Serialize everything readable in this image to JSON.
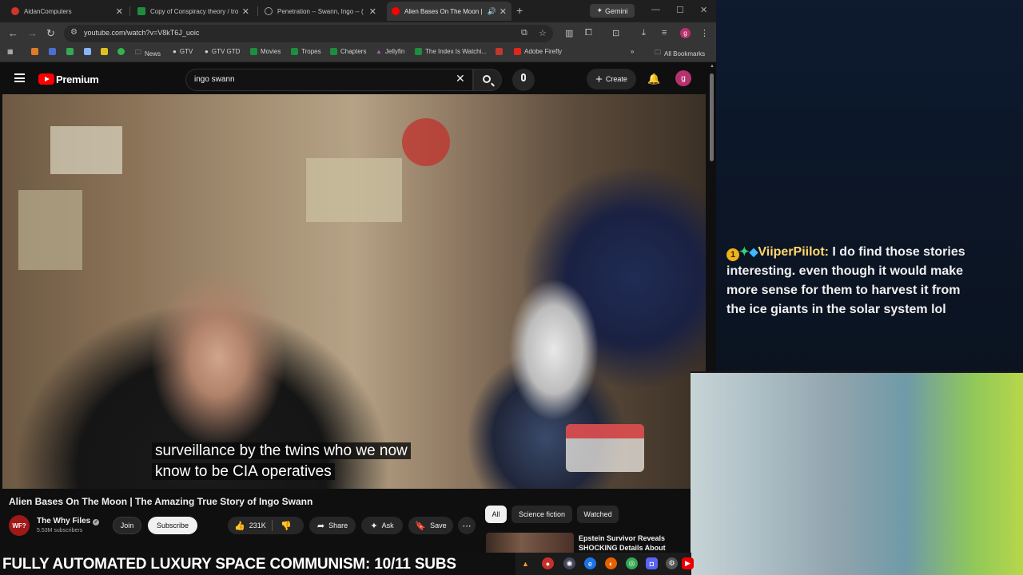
{
  "browser": {
    "tabs": [
      {
        "title": "AidanComputers",
        "color": "#d0342c"
      },
      {
        "title": "Copy of Conspiracy theory / tro",
        "color": "#1e8e3e"
      },
      {
        "title": "Penetration -- Swann, Ingo -- (",
        "color": "#9aa0a6"
      },
      {
        "title": "Alien Bases On The Moon |",
        "color": "#ff0000"
      }
    ],
    "gemini_label": "Gemini",
    "url": "youtube.com/watch?v=V8kT6J_uoic",
    "bookmarks": {
      "news": "News",
      "gtv": "GTV",
      "gtv_gtd": "GTV GTD",
      "movies": "Movies",
      "tropes": "Tropes",
      "chapters": "Chapters",
      "jellyfin": "Jellyfin",
      "index": "The Index Is Watchi...",
      "firefly": "Adobe Firefly",
      "all": "All Bookmarks"
    },
    "profile_initial": "g"
  },
  "youtube": {
    "brand": "Premium",
    "search_query": "ingo swann",
    "create_label": "Create",
    "avatar_initial": "g",
    "caption_line1": "surveillance by the twins who we now",
    "caption_line2": "know to be CIA operatives",
    "video_title": "Alien Bases On The Moon | The Amazing True Story of Ingo Swann",
    "channel": {
      "name": "The Why Files",
      "subscribers": "5.53M subscribers",
      "avatar_text": "WF?"
    },
    "join_label": "Join",
    "subscribe_label": "Subscribe",
    "like_count": "231K",
    "share_label": "Share",
    "ask_label": "Ask",
    "save_label": "Save",
    "chips": [
      "All",
      "Science fiction",
      "Watched"
    ],
    "recommended_title": "Epstein Survivor Reveals SHOCKING Details About"
  },
  "stream": {
    "chat_user": "ViiperPiilot:",
    "chat_message": " I do find those stories interesting. even though it would make more sense for them to harvest it from the ice giants in the solar system lol",
    "badge_number": "1",
    "ticker": "FULLY AUTOMATED LUXURY SPACE COMMUNISM: 10/11 SUBS"
  }
}
